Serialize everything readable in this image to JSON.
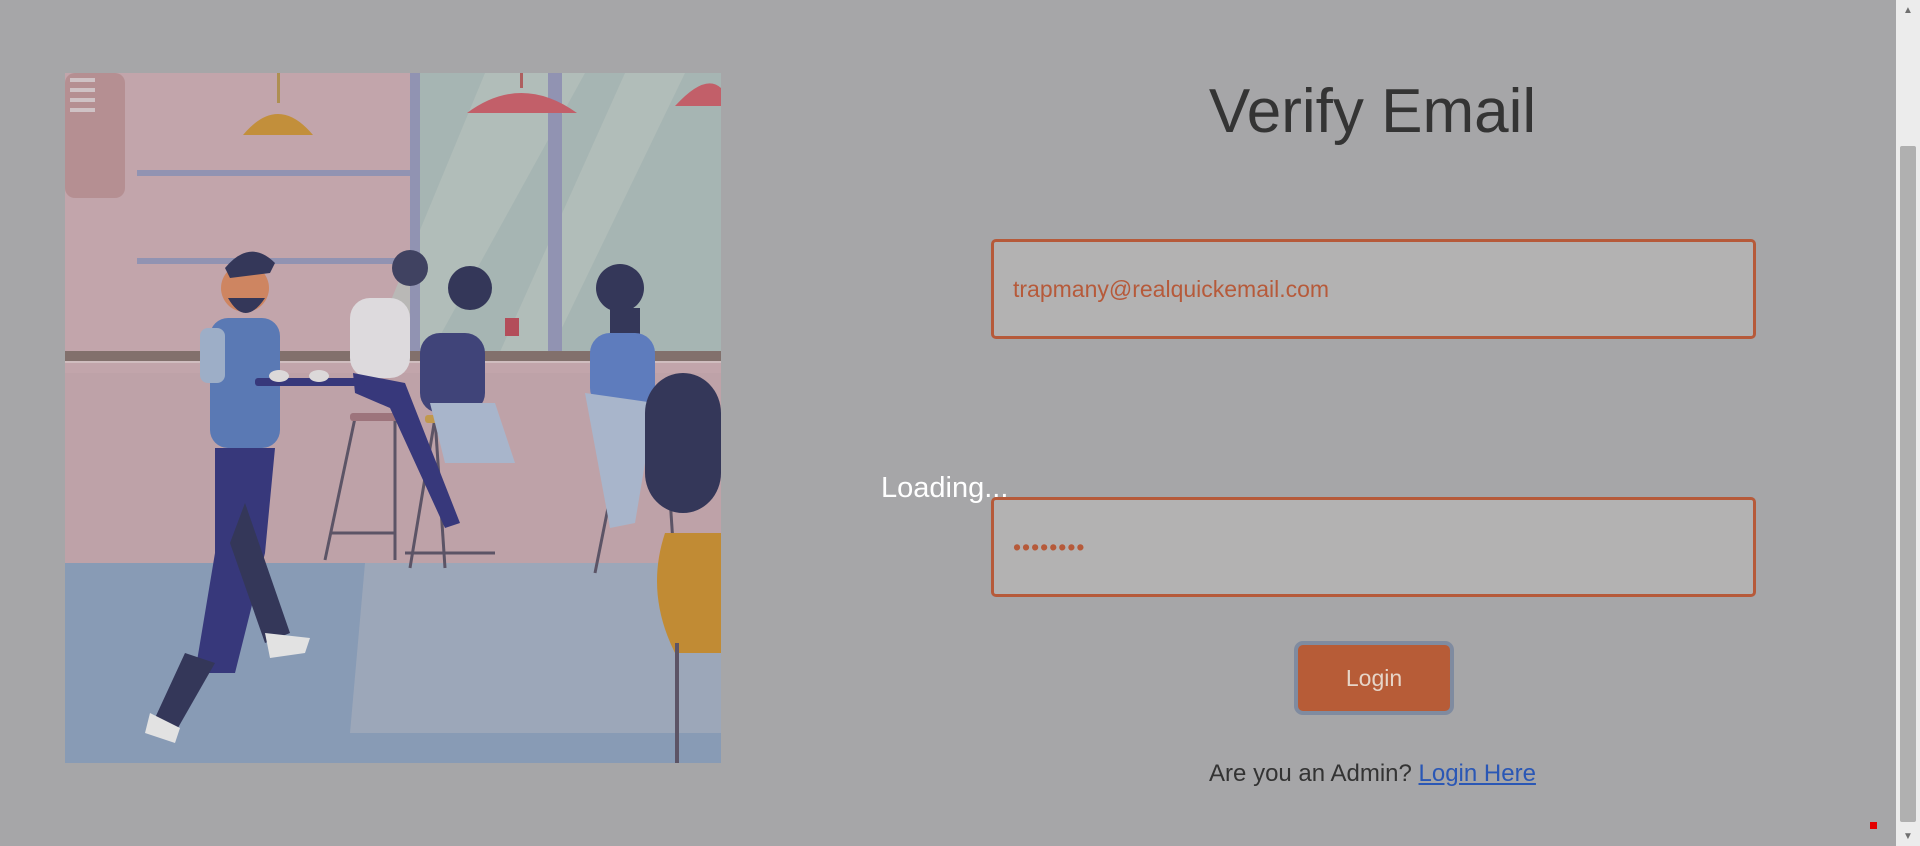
{
  "heading": "Verify Email",
  "form": {
    "email_value": "trapmany@realquickemail.com",
    "password_value": "12345678",
    "login_label": "Login"
  },
  "admin": {
    "prompt": "Are you an Admin?",
    "link_label": "Login Here"
  },
  "overlay": {
    "loading_text": "Loading..."
  },
  "illustration": {
    "icon": "cafe-illustration"
  },
  "colors": {
    "accent": "#b65a3a",
    "link": "#2a57b5",
    "overlay_bg": "#a6a6a8"
  }
}
